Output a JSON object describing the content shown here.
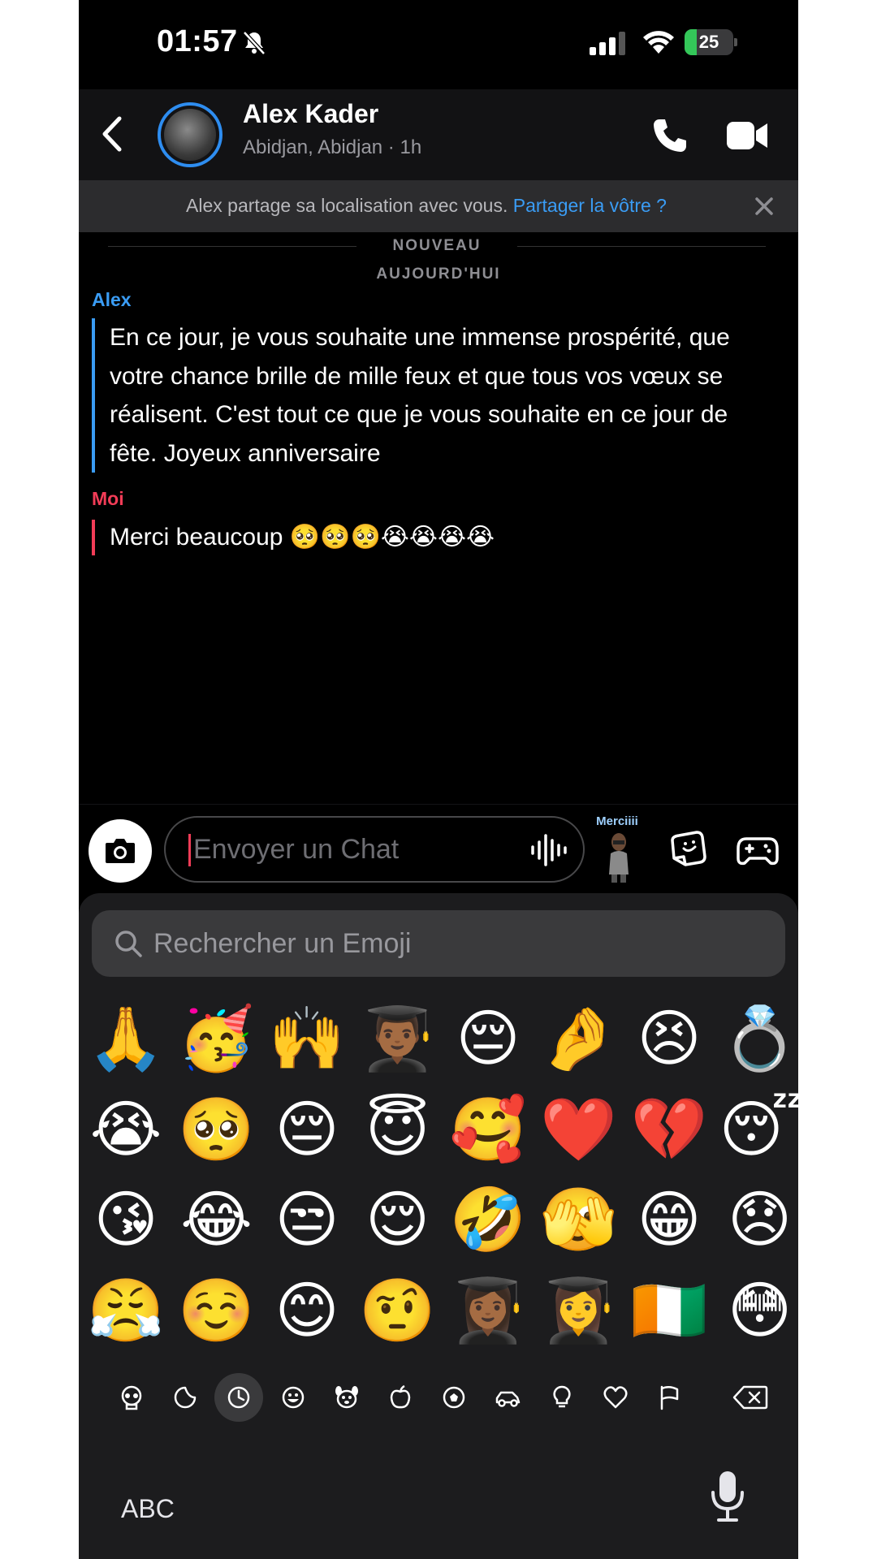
{
  "status_bar": {
    "time": "01:57",
    "battery_level": "25",
    "battery_fraction": 0.25
  },
  "header": {
    "contact_name": "Alex Kader",
    "contact_subtitle": "Abidjan, Abidjan · 1h"
  },
  "banner": {
    "text": "Alex partage sa localisation avec vous. ",
    "link": "Partager la vôtre ?"
  },
  "chat": {
    "new_label": "NOUVEAU",
    "day_label": "AUJOURD'HUI",
    "messages": [
      {
        "sender": "Alex",
        "text": "En ce jour, je vous souhaite une immense prospérité, que votre chance brille de mille feux et que tous vos vœux se réalisent. C'est tout ce que je vous souhaite en ce jour de fête. Joyeux anniversaire"
      },
      {
        "sender": "Moi",
        "text": "Merci beaucoup 🥺🥺🥺😭😭😭😭"
      }
    ]
  },
  "input": {
    "placeholder": "Envoyer un Chat",
    "bitmoji_label": "Merciiii"
  },
  "keyboard": {
    "search_placeholder": "Rechercher un Emoji",
    "emoji_rows": [
      [
        "🙏",
        "🥳",
        "🙌",
        "👨🏾‍🎓",
        "😔",
        "🤌",
        "😣",
        "💍"
      ],
      [
        "😭",
        "🥺",
        "😔",
        "😇",
        "🥰",
        "❤️",
        "💔",
        "😴"
      ],
      [
        "😘",
        "😂",
        "😒",
        "😌",
        "🤣",
        "🫣",
        "😁",
        "😞"
      ],
      [
        "😤",
        "☺️",
        "😊",
        "🤨",
        "👩🏾‍🎓",
        "👩‍🎓",
        "🇨🇮",
        "😳"
      ]
    ],
    "categories": [
      {
        "name": "skull-icon",
        "active": false
      },
      {
        "name": "sticker-icon",
        "active": false
      },
      {
        "name": "recent-icon",
        "active": true
      },
      {
        "name": "smiley-icon",
        "active": false
      },
      {
        "name": "animal-icon",
        "active": false
      },
      {
        "name": "food-icon",
        "active": false
      },
      {
        "name": "ball-icon",
        "active": false
      },
      {
        "name": "car-icon",
        "active": false
      },
      {
        "name": "bulb-icon",
        "active": false
      },
      {
        "name": "heart-icon",
        "active": false
      },
      {
        "name": "flag-icon",
        "active": false
      }
    ],
    "abc_label": "ABC"
  },
  "colors": {
    "alex": "#3a9cf4",
    "me": "#f23c57",
    "background": "#000000",
    "battery": "#34c759"
  }
}
